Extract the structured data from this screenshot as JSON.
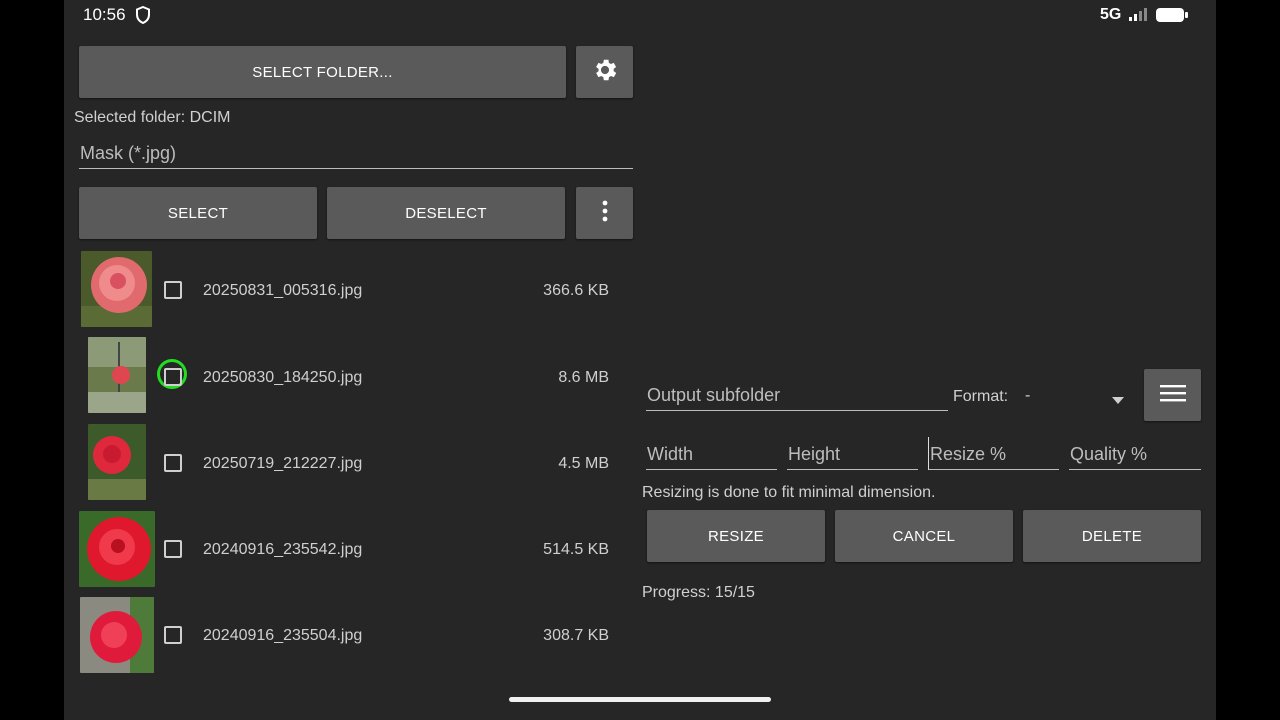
{
  "status": {
    "time": "10:56",
    "network": "5G"
  },
  "toolbar": {
    "select_folder_label": "SELECT FOLDER..."
  },
  "selected_folder_text": "Selected folder: DCIM",
  "mask": {
    "placeholder": "Mask (*.jpg)"
  },
  "selection": {
    "select_label": "SELECT",
    "deselect_label": "DESELECT"
  },
  "files": [
    {
      "name": "20250831_005316.jpg",
      "size": "366.6 KB",
      "checked": false
    },
    {
      "name": "20250830_184250.jpg",
      "size": "8.6 MB",
      "checked": false,
      "highlighted": true
    },
    {
      "name": "20250719_212227.jpg",
      "size": "4.5 MB",
      "checked": false
    },
    {
      "name": "20240916_235542.jpg",
      "size": "514.5 KB",
      "checked": false
    },
    {
      "name": "20240916_235504.jpg",
      "size": "308.7 KB",
      "checked": false
    }
  ],
  "output": {
    "subfolder_placeholder": "Output subfolder",
    "format_label": "Format:",
    "format_value": "-"
  },
  "dims": {
    "width_placeholder": "Width",
    "height_placeholder": "Height",
    "resize_placeholder": "Resize %",
    "quality_placeholder": "Quality %"
  },
  "hint": "Resizing is done to fit minimal dimension.",
  "actions": {
    "resize_label": "RESIZE",
    "cancel_label": "CANCEL",
    "delete_label": "DELETE"
  },
  "progress_text": "Progress: 15/15",
  "colors": {
    "background": "#262626",
    "button": "#5a5a5a",
    "highlight": "#22dd22"
  }
}
